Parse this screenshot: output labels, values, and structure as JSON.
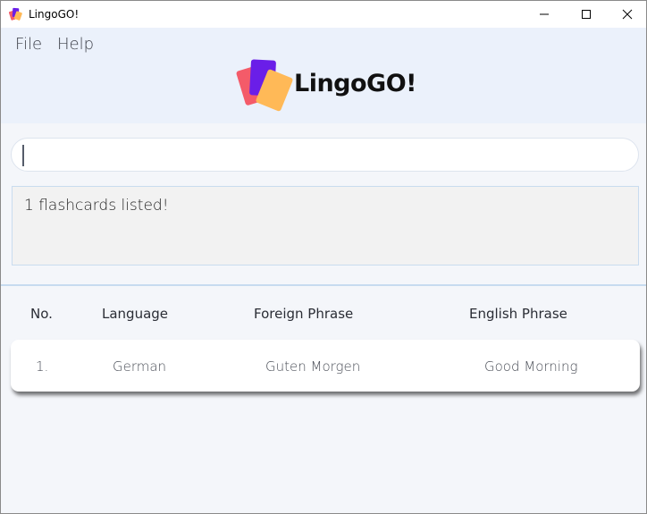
{
  "window": {
    "title": "LingoGO!",
    "icon": "lingogo-app-icon",
    "controls": [
      "minimize-icon",
      "maximize-icon",
      "close-icon"
    ]
  },
  "menu": {
    "file_label": "File",
    "help_label": "Help"
  },
  "brand": {
    "logo_text": "LingoGO!",
    "colors": {
      "red_card": "#f45b69",
      "purple_card": "#6a1ee8",
      "orange_card": "#ffb957"
    }
  },
  "command": {
    "value": "",
    "placeholder": ""
  },
  "result": {
    "message": "1 flashcards listed!"
  },
  "table": {
    "headers": {
      "no": "No.",
      "language": "Language",
      "foreign": "Foreign Phrase",
      "english": "English Phrase"
    },
    "rows": [
      {
        "no": "1.",
        "language": "German",
        "foreign": "Guten Morgen",
        "english": "Good Morning"
      }
    ]
  }
}
